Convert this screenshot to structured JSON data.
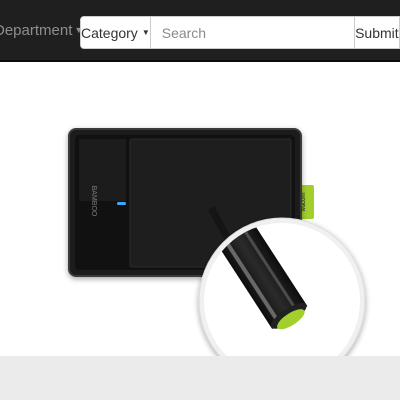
{
  "navbar": {
    "department_label": "Department",
    "category_label": "Category",
    "search_placeholder": "Search",
    "submit_label": "Submit"
  },
  "product": {
    "image_alt": "Wacom Bamboo pen tablet with stylus",
    "logo_text": "BAMBOO",
    "brand_tab_text": "wacom"
  },
  "colors": {
    "navbar_bg": "#1f1f1f",
    "accent_green": "#a2cf2b",
    "indicator_blue": "#3aa8ff",
    "footer_band": "#ebebeb"
  }
}
